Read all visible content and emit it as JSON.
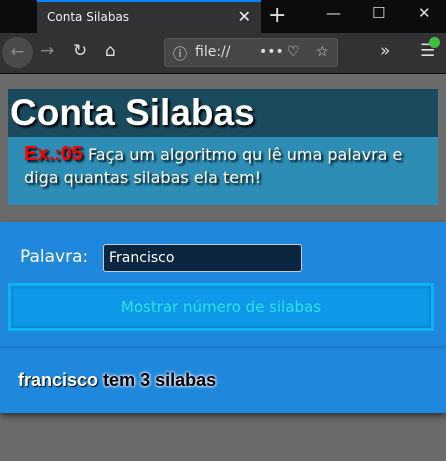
{
  "browser": {
    "tab_title": "Conta Silabas",
    "url": "file://",
    "window_controls": [
      "minimize",
      "maximize",
      "close"
    ]
  },
  "header": {
    "title": "Conta Silabas",
    "exercise": "Ex.:05",
    "description": "Faça um algoritmo qu lê uma palavra e diga quantas silabas ela tem!"
  },
  "form": {
    "label": "Palavra:",
    "input_value": "Francisco",
    "button_label": "Mostrar número de silabas"
  },
  "result": {
    "word": "francisco",
    "text": "tem 3 silabas"
  },
  "colors": {
    "header_dark": "#1a4a5e",
    "header_light": "#2d8db5",
    "panel": "#1f88dd",
    "exercise": "#ff0000"
  }
}
